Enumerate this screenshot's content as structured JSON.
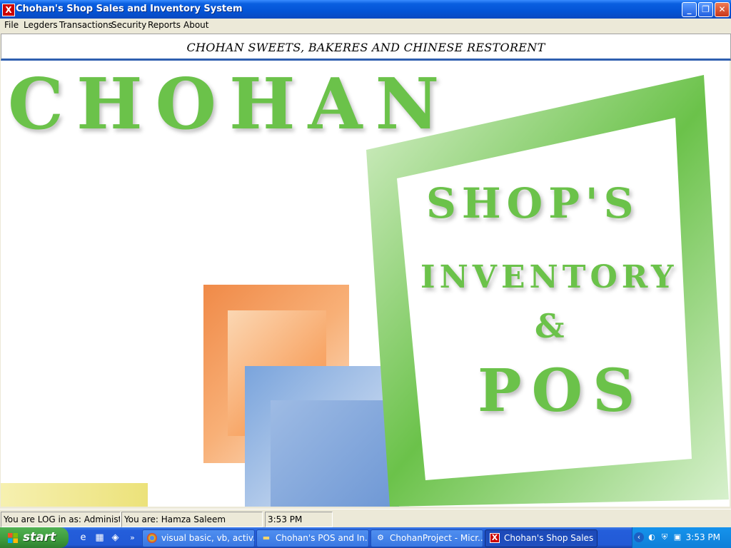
{
  "window": {
    "title": "Chohan's Shop Sales and Inventory System",
    "app_icon": "X",
    "minimize_icon": "minimize-icon",
    "restore_icon": "restore-icon",
    "close_icon": "close-icon"
  },
  "menu": {
    "items": [
      "File",
      "Legders",
      "Transactions",
      "Security",
      "Reports",
      "About"
    ]
  },
  "banner": {
    "text": "CHOHAN SWEETS, BAKERES AND CHINESE RESTORENT"
  },
  "splash": {
    "line1": "CHOHAN",
    "line2": "SHOP'S",
    "line3": "INVENTORY",
    "line4": "&",
    "line5": "POS",
    "accent_color": "#6bc24a"
  },
  "statusbar": {
    "login": "You are LOG in as: Administrator",
    "user": "You are: Hamza Saleem",
    "time": "3:53 PM"
  },
  "taskbar": {
    "start_label": "start",
    "tasks": [
      {
        "label": "visual basic, vb, activ...",
        "icon": "chrome-icon"
      },
      {
        "label": "Chohan's POS and In...",
        "icon": "folder-icon"
      },
      {
        "label": "ChohanProject - Micr...",
        "icon": "visual-studio-icon"
      },
      {
        "label": "Chohan's Shop Sales ...",
        "icon": "app-icon",
        "active": true
      }
    ],
    "clock": "3:53 PM"
  }
}
